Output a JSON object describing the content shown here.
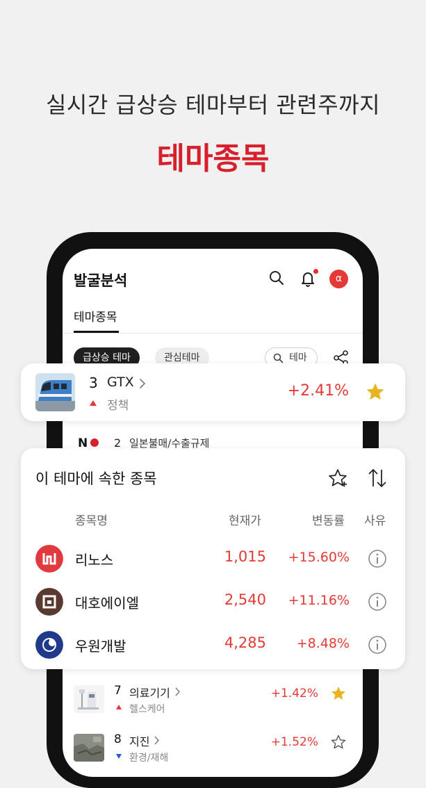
{
  "hero": {
    "subtitle": "실시간 급상승 테마부터 관련주까지",
    "title": "테마종목"
  },
  "header": {
    "title": "발굴분석",
    "alpha_badge": "α"
  },
  "tabs": [
    {
      "label": "테마종목",
      "active": true
    }
  ],
  "filters": {
    "chips": [
      "급상승 테마",
      "관심테마"
    ],
    "search_label": "테마"
  },
  "theme_list": [
    {
      "rank": "3",
      "name": "GTX",
      "category": "정책",
      "change": "+2.41%",
      "direction": "up",
      "starred": true,
      "icon": "train-thumbnail"
    },
    {
      "rank": "2",
      "name": "일본불매/수출규제",
      "logo_text": "N",
      "icon": "no-japan-logo"
    },
    {
      "rank": "7",
      "name": "의료기기",
      "category": "헬스케어",
      "change": "+1.42%",
      "direction": "up",
      "starred": true,
      "icon": "medical-device-thumbnail"
    },
    {
      "rank": "8",
      "name": "지진",
      "category": "환경/재해",
      "change": "+1.52%",
      "direction": "down",
      "starred": false,
      "icon": "earthquake-thumbnail"
    }
  ],
  "stock_panel": {
    "title": "이 테마에 속한 종목",
    "columns": {
      "name": "종목명",
      "price": "현재가",
      "change": "변동률",
      "reason": "사유"
    },
    "rows": [
      {
        "name": "리노스",
        "price": "1,015",
        "change": "+15.60%",
        "logo_color": "#e03a3e"
      },
      {
        "name": "대호에이엘",
        "price": "2,540",
        "change": "+11.16%",
        "logo_color": "#5a3a2e"
      },
      {
        "name": "우원개발",
        "price": "4,285",
        "change": "+8.48%",
        "logo_color": "#1f3a8a"
      }
    ]
  },
  "colors": {
    "accent_red": "#d8202c",
    "up_red": "#e53935",
    "down_blue": "#2a5bd7",
    "star_gold": "#e8b420"
  }
}
